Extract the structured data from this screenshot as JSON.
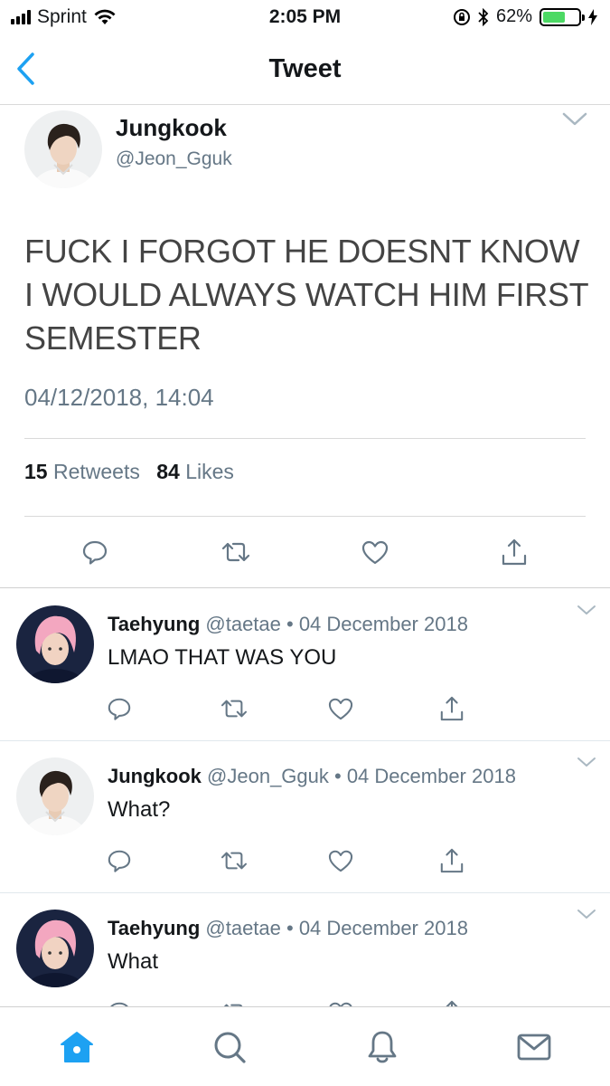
{
  "status_bar": {
    "carrier": "Sprint",
    "time": "2:05 PM",
    "battery": "62%",
    "battery_level": 0.62
  },
  "nav": {
    "title": "Tweet"
  },
  "main_tweet": {
    "name": "Jungkook",
    "handle": "@Jeon_Gguk",
    "text": "FUCK I FORGOT HE DOESNT KNOW I WOULD ALWAYS WATCH HIM FIRST SEMESTER",
    "date": "04/12/2018, 14:04",
    "retweets_count": "15",
    "retweets_label": "Retweets",
    "likes_count": "84",
    "likes_label": "Likes"
  },
  "replies": [
    {
      "name": "Taehyung",
      "meta": "@taetae • 04 December 2018",
      "text": "LMAO THAT WAS YOU"
    },
    {
      "name": "Jungkook",
      "meta": "@Jeon_Gguk • 04 December 2018",
      "text": "What?"
    },
    {
      "name": "Taehyung",
      "meta": "@taetae • 04 December 2018",
      "text": "What"
    }
  ],
  "icons": {
    "back": "chevron-left-icon",
    "caret": "chevron-down-icon",
    "reply": "reply-icon",
    "retweet": "retweet-icon",
    "like": "heart-icon",
    "share": "share-icon",
    "home": "home-icon",
    "search": "search-icon",
    "notifications": "bell-icon",
    "messages": "mail-icon"
  },
  "colors": {
    "accent": "#1da1f2",
    "secondary_text": "#657786",
    "icon_gray": "#657786",
    "battery": "#4cd964"
  }
}
